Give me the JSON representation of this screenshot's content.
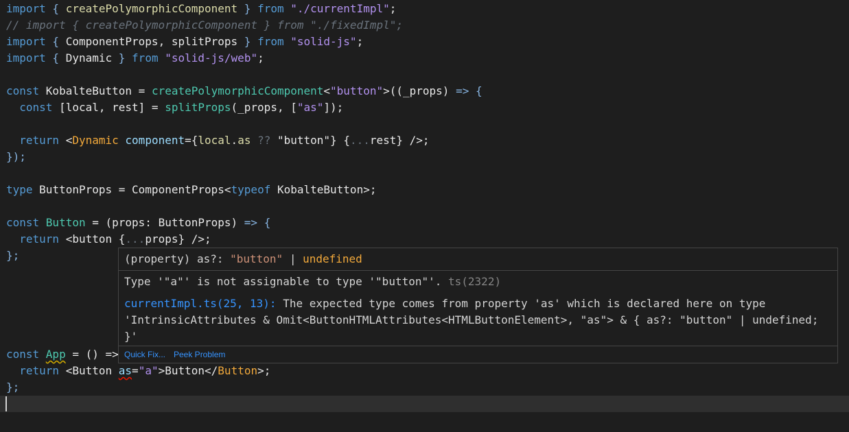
{
  "code": {
    "l1": {
      "kw": "import",
      "open": " { ",
      "fn": "createPolymorphicComponent",
      "close": " } ",
      "from": "from ",
      "str": "\"./currentImpl\"",
      "end": ";"
    },
    "l2": {
      "comment": "// import { createPolymorphicComponent } from \"./fixedImpl\";"
    },
    "l3": {
      "kw": "import",
      "open": " { ",
      "names": "ComponentProps, splitProps",
      "close": " } ",
      "from": "from ",
      "str": "\"solid-js\"",
      "end": ";"
    },
    "l4": {
      "kw": "import",
      "open": " { ",
      "names": "Dynamic",
      "close": " } ",
      "from": "from ",
      "str": "\"solid-js/web\"",
      "end": ";"
    },
    "l6": {
      "kw": "const ",
      "name": "KobalteButton",
      "eq": " = ",
      "fn": "createPolymorphicComponent",
      "lt": "<",
      "str": "\"button\"",
      "rest": ">((_props) ",
      "arrow": "=> {"
    },
    "l7": {
      "kw": "const ",
      "rest": "[local, rest] = ",
      "fn": "splitProps",
      "args": "(_props, [",
      "str": "\"as\"",
      "end": "]);"
    },
    "l9": {
      "kw": "return ",
      "lt": "<",
      "tag": "Dynamic",
      "attr": " component",
      "eq": "={",
      "v1": "local",
      "dot": ".",
      "v2": "as",
      "nn": " ?? ",
      "str": "\"button\"",
      "close": "} {",
      "spread": "...",
      "rest": "rest} />;"
    },
    "l10": {
      "text": "});"
    },
    "l12": {
      "kw": "type ",
      "name": "ButtonProps = ComponentProps<",
      "kw2": "typeof ",
      "rest": "KobalteButton>;"
    },
    "l14": {
      "kw": "const ",
      "name": "Button",
      "eq": " = (props",
      "colon": ": ",
      "type": "ButtonProps",
      "rest": ") ",
      "arrow": "=> {"
    },
    "l15": {
      "kw": "return ",
      "lt": "<",
      "tag": "button",
      "rest": " {",
      "spread": "...",
      "rest2": "props} />;"
    },
    "l16": {
      "text": "};"
    },
    "l22": {
      "kw": "const ",
      "name": "App",
      "eq": " = () =>"
    },
    "l23": {
      "kw": "return ",
      "lt": "<",
      "tag": "Button",
      "sp": " ",
      "attr": "as",
      "eq": "=",
      "str": "\"a\"",
      "gt": ">",
      "text": "Button",
      "close": "</",
      "tag2": "Button",
      "end": ">;"
    },
    "l24": {
      "text": "};"
    }
  },
  "hover": {
    "sig_prefix": "(property) as?: ",
    "sig_type": "\"button\"",
    "sig_sep": " | ",
    "sig_undef": "undefined",
    "error_text": "Type '\"a\"' is not assignable to type '\"button\"'. ",
    "error_code": "ts(2322)",
    "related_link": "currentImpl.ts(25, 13):",
    "related_text1": " The expected type comes from property 'as' which is declared here on type",
    "related_text2": "'IntrinsicAttributes & Omit<ButtonHTMLAttributes<HTMLButtonElement>, \"as\"> & { as?: \"button\" | undefined;",
    "related_text3": "}'",
    "quick_fix": "Quick Fix...",
    "peek_problem": "Peek Problem"
  },
  "colors": {
    "background": "#1e1e1e",
    "keyword": "#569cd6",
    "function": "#dcdcaa",
    "type": "#4ec9b0",
    "link": "#3794ff",
    "error_squiggle": "#e51400"
  }
}
